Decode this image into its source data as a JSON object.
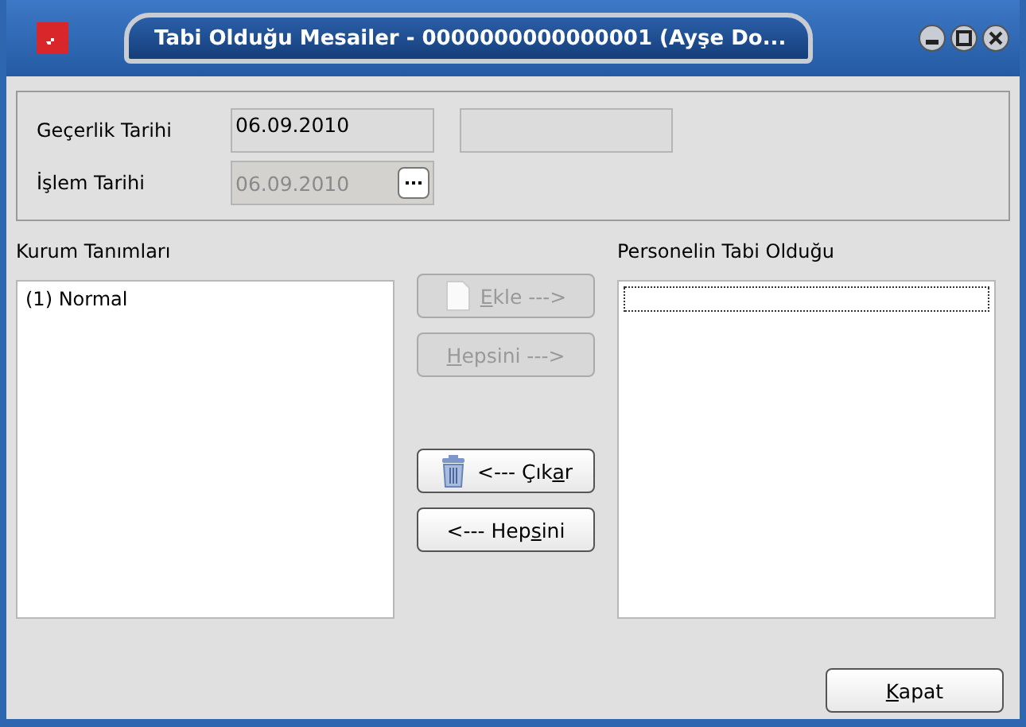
{
  "window": {
    "title": "Tabi Olduğu Mesailer - 0000000000000001 (Ayşe Do..."
  },
  "fields": [
    {
      "label": "Geçerlik Tarihi",
      "value": "06.09.2010",
      "disabled": false,
      "extra_field": true
    },
    {
      "label": "İşlem Tarihi",
      "value": "06.09.2010",
      "disabled": true,
      "has_button": true
    }
  ],
  "left_list": {
    "title": "Kurum Tanımları",
    "items": [
      {
        "label": "(1) Normal",
        "selected": false
      }
    ]
  },
  "right_list": {
    "title": "Personelin Tabi Olduğu",
    "focused": true
  },
  "buttons": [
    {
      "key": "E",
      "post": "kle --->",
      "disabled": true
    },
    {
      "key": "H",
      "post": "epsini --->",
      "disabled": true
    },
    {
      "pre": "<--- Çık",
      "key": "a",
      "post": "r",
      "disabled": false
    },
    {
      "pre": "<--- Hep",
      "key": "s",
      "post": "ini",
      "disabled": false
    }
  ],
  "close_button": {
    "key": "K",
    "post": "apat"
  }
}
